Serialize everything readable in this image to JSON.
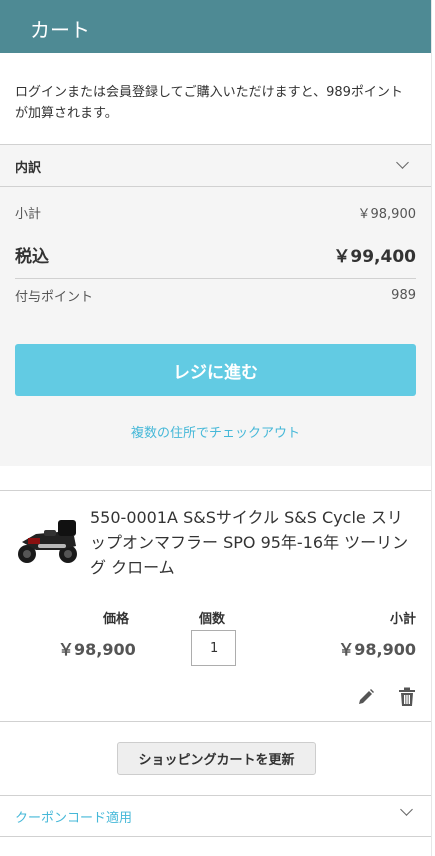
{
  "header": {
    "title": "カート"
  },
  "notice": {
    "text": "ログインまたは会員登録してご購入いただけますと、989ポイントが加算されます。"
  },
  "summary": {
    "title": "内訳",
    "subtotal_label": "小計",
    "subtotal_value": "￥98,900",
    "total_label": "税込",
    "total_value": "￥99,400",
    "points_label": "付与ポイント",
    "points_value": "989"
  },
  "checkout": {
    "button_label": "レジに進む",
    "multi_address_link": "複数の住所でチェックアウト"
  },
  "item": {
    "name": "550-0001A S&Sサイクル S&S Cycle スリップオンマフラー SPO 95年-16年 ツーリング クローム",
    "price_label": "価格",
    "price_value": "￥98,900",
    "qty_label": "個数",
    "qty_value": "1",
    "subtotal_label": "小計",
    "subtotal_value": "￥98,900",
    "edit_icon": "pencil-icon",
    "delete_icon": "trash-icon"
  },
  "cart_actions": {
    "update_label": "ショッピングカートを更新"
  },
  "coupon": {
    "label": "クーポンコード適用"
  },
  "colors": {
    "header_bg": "#4e8a94",
    "checkout_bg": "#62cbe3",
    "link": "#46b8d8",
    "summary_bg": "#f5f5f5"
  }
}
